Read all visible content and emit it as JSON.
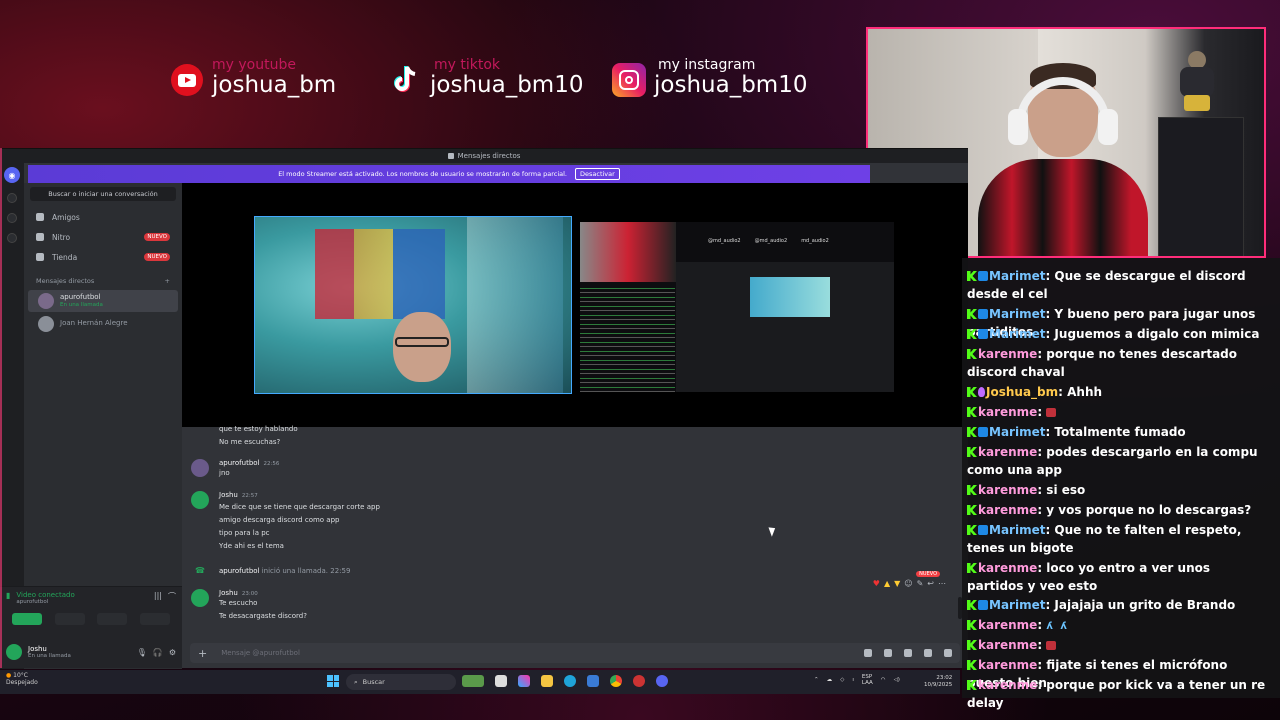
{
  "socials": [
    {
      "label": "my youtube",
      "handle": "joshua_bm",
      "color": "#c2185b",
      "icon": "youtube-icon"
    },
    {
      "label": "my tiktok",
      "handle": "joshua_bm10",
      "color": "#c2185b",
      "icon": "tiktok-icon"
    },
    {
      "label": "my instagram",
      "handle": "joshua_bm10",
      "color": "#ffffff",
      "icon": "instagram-icon"
    }
  ],
  "discord": {
    "window_title": "Mensajes directos",
    "banner_text": "El modo Streamer está activado. Los nombres de usuario se mostrarán de forma parcial.",
    "banner_button": "Desactivar",
    "search_placeholder": "Buscar o iniciar una conversación",
    "nav": [
      {
        "label": "Amigos",
        "badge": ""
      },
      {
        "label": "Nitro",
        "badge": "NUEVO"
      },
      {
        "label": "Tienda",
        "badge": "NUEVO"
      }
    ],
    "dm_header": "Mensajes directos",
    "dm_header_add": "+",
    "dms": [
      {
        "name": "apurofutbol",
        "status": "En una llamada"
      },
      {
        "name": "Joan Hernán Alegre",
        "status": ""
      }
    ],
    "voice": {
      "status": "Video conectado",
      "channel": "apurofutbol"
    },
    "user": {
      "name": "Joshu",
      "status": "En una llamada"
    },
    "share_labels": [
      "@md_audio2",
      "@md_audio2",
      "md_audio2"
    ],
    "messages": {
      "top_line1": "que te estoy hablando",
      "top_line2": "No me escuchas?",
      "m1_author": "apurofutbol",
      "m1_time": "22:56",
      "m1_text": "jno",
      "m2_author": "Joshu",
      "m2_time": "22:57",
      "m2_lines": [
        "Me dice que se tiene que descargar corte app",
        "amigo descarga discord como app",
        "tipo para la pc",
        "Yde ahi es el tema"
      ],
      "call_author": "apurofutbol",
      "call_text": "inició una llamada.",
      "call_time": "22:59",
      "nuevo": "NUEVO",
      "m3_author": "Joshu",
      "m3_time": "23:00",
      "m3_lines": [
        "Te escucho",
        "Te desacargaste discord?"
      ]
    },
    "input_placeholder": "Mensaje @apurofutbol"
  },
  "taskbar": {
    "weather_temp": "10°C",
    "weather_desc": "Despejado",
    "search_label": "Buscar",
    "lang": "ESP",
    "lang2": "LAA",
    "time": "23:02",
    "date": "10/9/2025"
  },
  "chat": [
    {
      "user": "Marimet",
      "text": ": Que se descargue el discord desde el cel",
      "mod": true,
      "kind": "mod"
    },
    {
      "user": "Marimet",
      "text": ": Y bueno pero para jugar unos partiditos",
      "mod": true,
      "kind": "mod"
    },
    {
      "user": "Marimet",
      "text": ": Juguemos a digalo con mimica",
      "mod": true,
      "kind": "mod"
    },
    {
      "user": "karenme",
      "text": ": porque no tenes descartado discord chaval",
      "mod": false,
      "kind": "karen"
    },
    {
      "user": "Joshua_bm",
      "text": ": Ahhh",
      "mod": false,
      "kind": "self"
    },
    {
      "user": "karenme",
      "text": ": ",
      "mod": false,
      "kind": "karen",
      "emote": "red"
    },
    {
      "user": "Marimet",
      "text": ": Totalmente fumado",
      "mod": true,
      "kind": "mod"
    },
    {
      "user": "karenme",
      "text": ": podes descargarlo en la compu como una app",
      "mod": false,
      "kind": "karen"
    },
    {
      "user": "karenme",
      "text": ": si eso",
      "mod": false,
      "kind": "karen"
    },
    {
      "user": "karenme",
      "text": ": y vos porque no lo descargas?",
      "mod": false,
      "kind": "karen"
    },
    {
      "user": "Marimet",
      "text": ": Que no te falten el respeto, tenes un bigote",
      "mod": true,
      "kind": "mod"
    },
    {
      "user": "karenme",
      "text": ": loco yo entro a ver unos partidos y veo esto",
      "mod": false,
      "kind": "karen"
    },
    {
      "user": "Marimet",
      "text": ": Jajajaja un grito de Brando",
      "mod": true,
      "kind": "mod"
    },
    {
      "user": "karenme",
      "text": ": ",
      "mod": false,
      "kind": "karen",
      "emote": "blue"
    },
    {
      "user": "karenme",
      "text": ": ",
      "mod": false,
      "kind": "karen",
      "emote": "red"
    },
    {
      "user": "karenme",
      "text": ": fijate si tenes el micrófono puesto bien",
      "mod": false,
      "kind": "karen"
    },
    {
      "user": "karenme",
      "text": ": porque por kick va a tener un re delay",
      "mod": false,
      "kind": "karen"
    }
  ]
}
